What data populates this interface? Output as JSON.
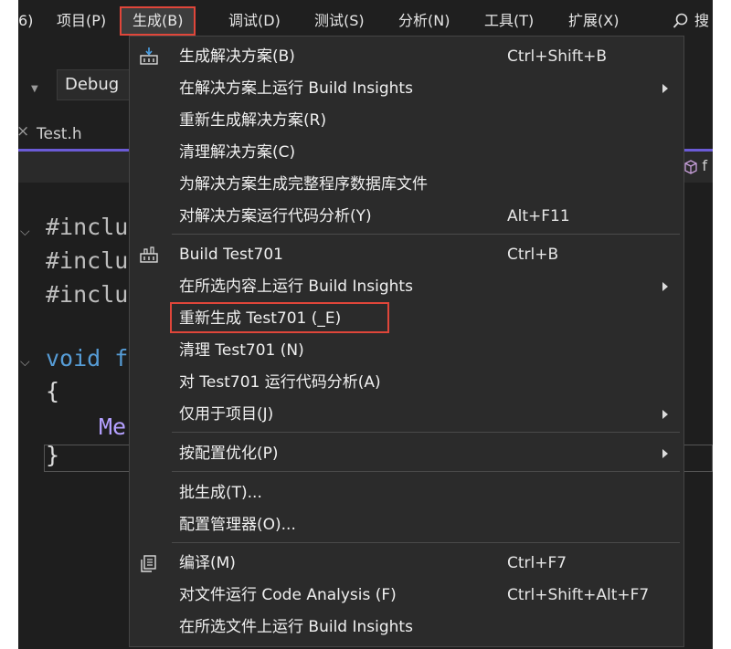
{
  "menubar": {
    "items": [
      {
        "label": "6)"
      },
      {
        "label": "项目(P)"
      },
      {
        "label": "生成(B)"
      },
      {
        "label": "调试(D)"
      },
      {
        "label": "测试(S)"
      },
      {
        "label": "分析(N)"
      },
      {
        "label": "工具(T)"
      },
      {
        "label": "扩展(X)"
      }
    ],
    "search_glyph": "搜"
  },
  "toolbar": {
    "config": "Debug"
  },
  "tabs": {
    "active": "Test.h",
    "right_fragment": "f"
  },
  "code": {
    "lines": [
      "#inclu",
      "#inclu",
      "#inclu",
      "void f",
      "{",
      "Me",
      "}"
    ]
  },
  "build_menu": {
    "sections": [
      {
        "items": [
          {
            "label": "生成解决方案(B)",
            "shortcut": "Ctrl+Shift+B",
            "icon": "build-solution-icon",
            "submenu": false
          },
          {
            "label": "在解决方案上运行 Build Insights",
            "shortcut": "",
            "submenu": true
          },
          {
            "label": "重新生成解决方案(R)",
            "shortcut": "",
            "submenu": false
          },
          {
            "label": "清理解决方案(C)",
            "shortcut": "",
            "submenu": false
          },
          {
            "label": "为解决方案生成完整程序数据库文件",
            "shortcut": "",
            "submenu": false
          },
          {
            "label": "对解决方案运行代码分析(Y)",
            "shortcut": "Alt+F11",
            "submenu": false
          }
        ]
      },
      {
        "items": [
          {
            "label": "Build Test701",
            "shortcut": "Ctrl+B",
            "icon": "build-project-icon",
            "submenu": false
          },
          {
            "label": "在所选内容上运行 Build Insights",
            "shortcut": "",
            "submenu": true
          },
          {
            "label": "重新生成 Test701 (_E)",
            "shortcut": "",
            "submenu": false,
            "highlighted": true
          },
          {
            "label": "清理 Test701 (N)",
            "shortcut": "",
            "submenu": false
          },
          {
            "label": "对 Test701 运行代码分析(A)",
            "shortcut": "",
            "submenu": false
          },
          {
            "label": "仅用于项目(J)",
            "shortcut": "",
            "submenu": true
          }
        ]
      },
      {
        "items": [
          {
            "label": "按配置优化(P)",
            "shortcut": "",
            "submenu": true
          }
        ]
      },
      {
        "items": [
          {
            "label": "批生成(T)...",
            "shortcut": "",
            "submenu": false
          },
          {
            "label": "配置管理器(O)...",
            "shortcut": "",
            "submenu": false
          }
        ]
      },
      {
        "items": [
          {
            "label": "编译(M)",
            "shortcut": "Ctrl+F7",
            "icon": "compile-icon",
            "submenu": false
          },
          {
            "label": "对文件运行 Code Analysis (F)",
            "shortcut": "Ctrl+Shift+Alt+F7",
            "submenu": false
          },
          {
            "label": "在所选文件上运行 Build Insights",
            "shortcut": "",
            "submenu": false
          }
        ]
      }
    ]
  },
  "colors": {
    "highlight_box": "#e0463a",
    "menu_bg": "#2b2b2b",
    "editor_bg": "#1e1e1e",
    "tab_accent": "#6b5bd6"
  }
}
